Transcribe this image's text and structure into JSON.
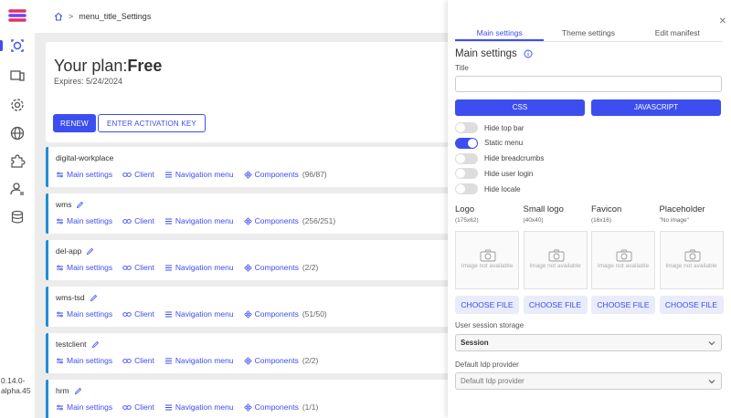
{
  "app": {
    "version": "0.14.0-alpha.45"
  },
  "breadcrumb": {
    "title": "menu_title_Settings"
  },
  "colors": {
    "accent": "#3d4ef0",
    "client_bar": "#1f8ed8"
  },
  "plan": {
    "label": "Your plan:",
    "name": "Free",
    "expires": "Expires: 5/24/2024",
    "renew_label": "RENEW",
    "activation_label": "ENTER ACTIVATION KEY"
  },
  "link_labels": {
    "main": "Main settings",
    "client": "Client",
    "nav": "Navigation menu",
    "components": "Components"
  },
  "clients": [
    {
      "name": "digital-workplace",
      "count": "(96/87)"
    },
    {
      "name": "wms",
      "count": "(256/251)"
    },
    {
      "name": "del-app",
      "count": "(2/2)"
    },
    {
      "name": "wms-tsd",
      "count": "(51/50)"
    },
    {
      "name": "testclient",
      "count": "(2/2)"
    },
    {
      "name": "hrm",
      "count": "(1/1)"
    }
  ],
  "panel": {
    "tabs": [
      "Main settings",
      "Theme settings",
      "Edit manifest"
    ],
    "section_title": "Main settings",
    "title_label": "Title",
    "title_value": "",
    "css_label": "CSS",
    "js_label": "JAVASCRIPT",
    "toggles": [
      {
        "label": "Hide top bar",
        "on": false
      },
      {
        "label": "Static menu",
        "on": true
      },
      {
        "label": "Hide breadcrumbs",
        "on": false
      },
      {
        "label": "Hide user login",
        "on": false
      },
      {
        "label": "Hide locale",
        "on": false
      }
    ],
    "images": [
      {
        "title": "Logo",
        "size": "(175x62)"
      },
      {
        "title": "Small logo",
        "size": "(40x40)"
      },
      {
        "title": "Favicon",
        "size": "(16x16)"
      },
      {
        "title": "Placeholder",
        "size": "\"No image\""
      }
    ],
    "image_na": "Image not available",
    "choose_file": "CHOOSE FILE",
    "session_label": "User session storage",
    "session_value": "Session",
    "idp_label": "Default Idp provider",
    "idp_placeholder": "Default Idp provider"
  }
}
